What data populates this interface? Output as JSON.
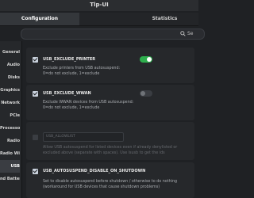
{
  "window": {
    "title": "Tlp-UI"
  },
  "tabs": [
    {
      "label": "Configuration",
      "active": true
    },
    {
      "label": "Statistics",
      "active": false
    }
  ],
  "search": {
    "label": "Se"
  },
  "sidebar": {
    "items": [
      {
        "label": "General"
      },
      {
        "label": "Audio"
      },
      {
        "label": "Disks"
      },
      {
        "label": "Graphics"
      },
      {
        "label": "Network"
      },
      {
        "label": "PCIe"
      },
      {
        "label": "Processor"
      },
      {
        "label": "Radio"
      },
      {
        "label": "Radio Wizard"
      },
      {
        "label": "USB"
      },
      {
        "label": "nd Battery"
      }
    ]
  },
  "options": [
    {
      "name": "USB_EXCLUDE_PRINTER",
      "checked": true,
      "toggle_on": true,
      "description": [
        "Exclude printers from USB autosuspend:",
        "0=do not exclude, 1=exclude"
      ]
    },
    {
      "name": "USB_EXCLUDE_WWAN",
      "checked": true,
      "toggle_on": false,
      "description": [
        "Exclude WWAN devices from USB autosuspend:",
        "0=do not exclude, 1=exclude"
      ]
    },
    {
      "name": "USB_ALLOWLIST",
      "checked": false,
      "description": [
        "Allow USB autosuspend for listed devices even if already denylisted or",
        "excluded above (separate with spaces). Use lsusb to get the ids"
      ]
    },
    {
      "name": "USB_AUTOSUSPEND_DISABLE_ON_SHUTDOWN",
      "checked": true,
      "description": [
        "Set to disable autosuspend before shutdown / otherwise to do nothing",
        "(workaround for USB devices that cause shutdown problems)"
      ]
    }
  ],
  "colors": {
    "accent_toggle": "#2eae4d",
    "background": "#1f2124",
    "card": "#26282b"
  }
}
